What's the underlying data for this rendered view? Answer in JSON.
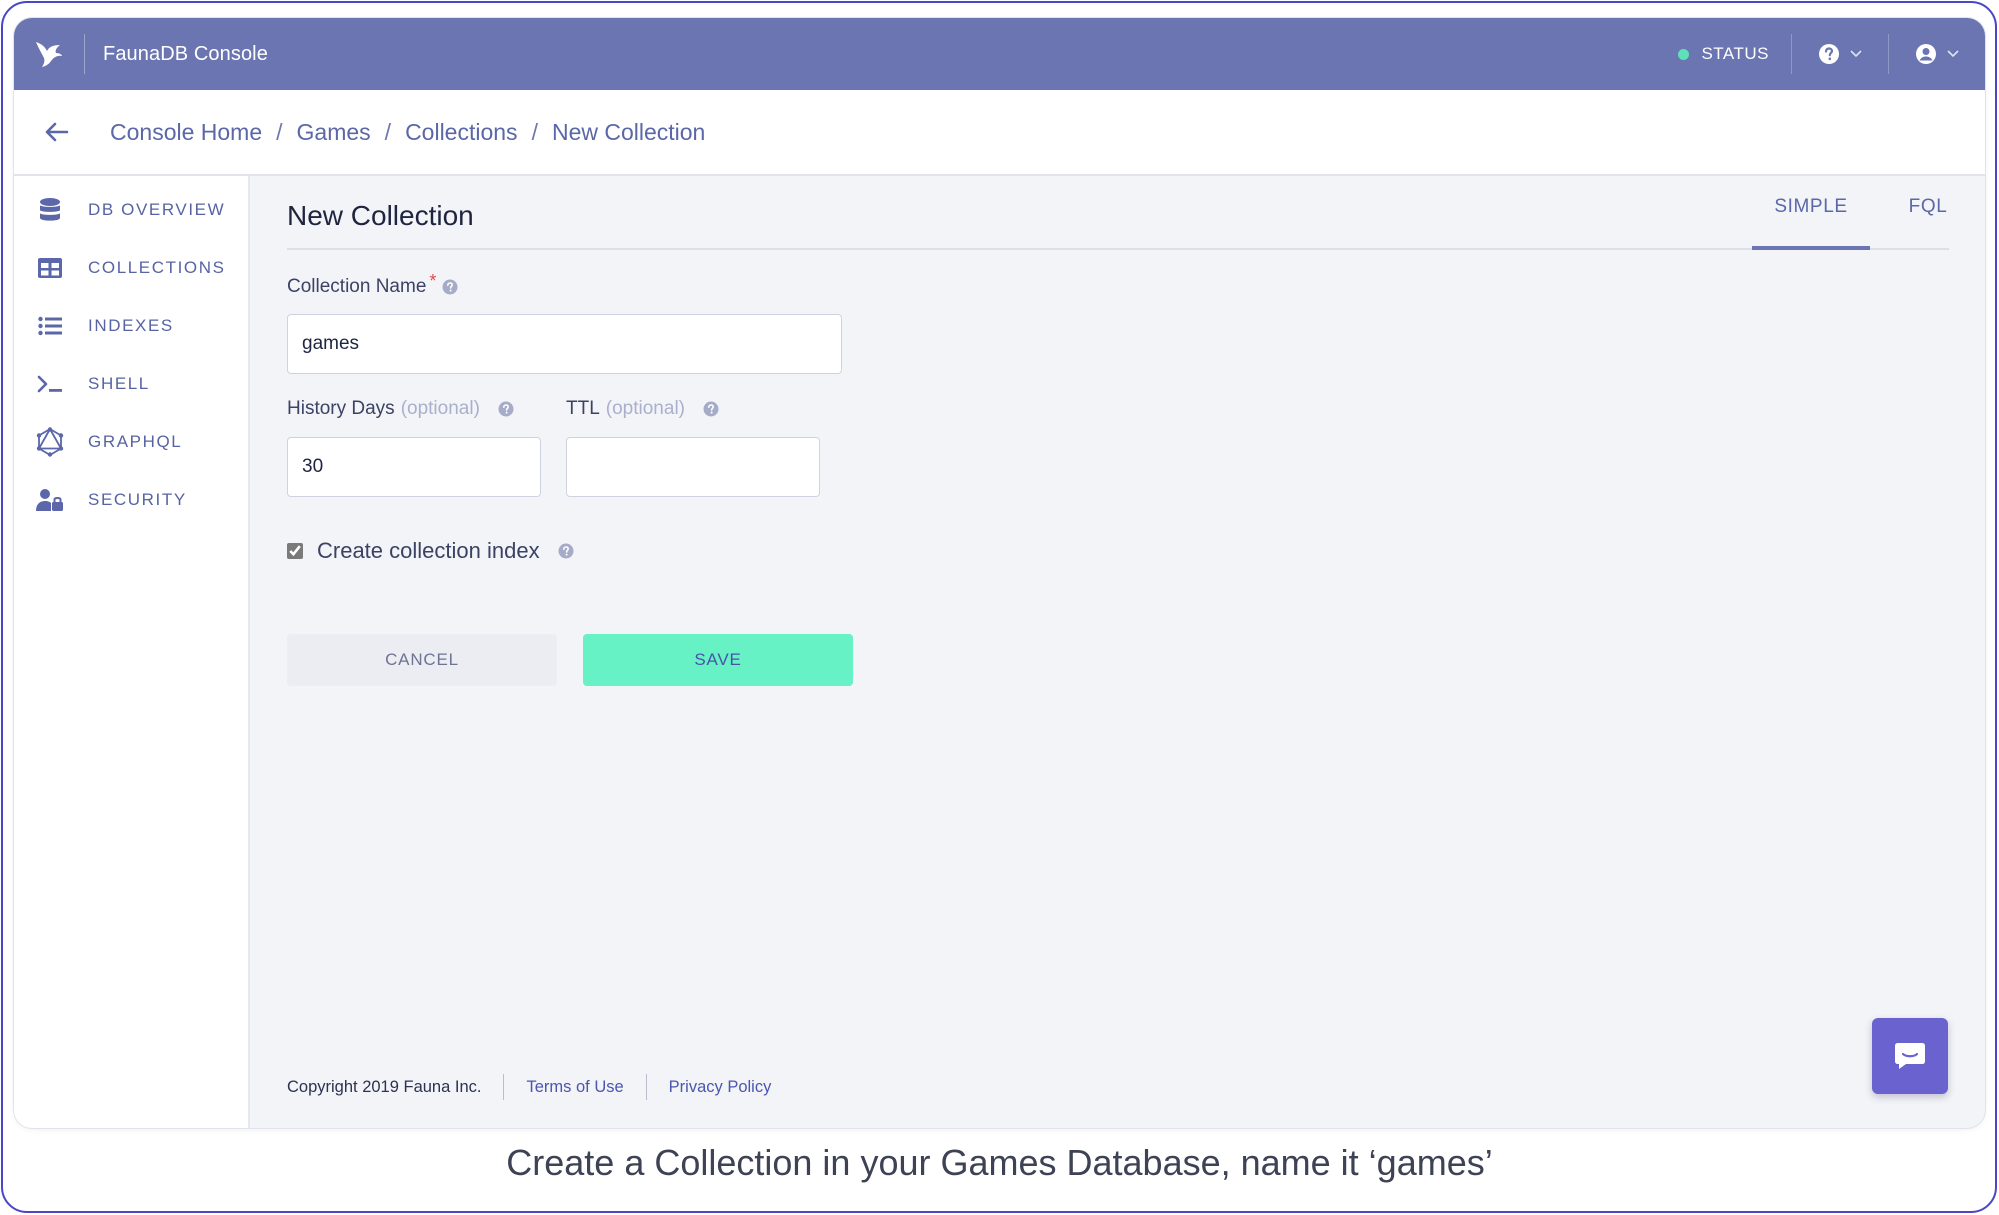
{
  "app": {
    "title": "FaunaDB Console"
  },
  "topbar": {
    "status_label": "STATUS"
  },
  "breadcrumb": {
    "items": [
      "Console Home",
      "Games",
      "Collections",
      "New Collection"
    ],
    "separator": "/"
  },
  "sidebar": {
    "items": [
      {
        "label": "DB OVERVIEW",
        "icon": "database-icon"
      },
      {
        "label": "COLLECTIONS",
        "icon": "table-icon"
      },
      {
        "label": "INDEXES",
        "icon": "list-icon"
      },
      {
        "label": "SHELL",
        "icon": "terminal-icon"
      },
      {
        "label": "GRAPHQL",
        "icon": "graphql-icon"
      },
      {
        "label": "SECURITY",
        "icon": "user-lock-icon"
      }
    ]
  },
  "main": {
    "title": "New Collection",
    "tabs": [
      {
        "label": "SIMPLE",
        "active": true
      },
      {
        "label": "FQL",
        "active": false
      }
    ],
    "form": {
      "collection_name": {
        "label": "Collection Name",
        "required_mark": "*",
        "value": "games"
      },
      "history_days": {
        "label": "History Days",
        "optional": "(optional)",
        "value": "30"
      },
      "ttl": {
        "label": "TTL",
        "optional": "(optional)",
        "value": ""
      },
      "create_index": {
        "label": "Create collection index",
        "checked": true
      },
      "cancel_label": "CANCEL",
      "save_label": "SAVE"
    },
    "footer": {
      "copyright": "Copyright 2019 Fauna Inc.",
      "terms": "Terms of Use",
      "privacy": "Privacy Policy"
    }
  },
  "caption": "Create a Collection in your Games Database, name it ‘games’",
  "colors": {
    "topbar": "#6a75b1",
    "accent": "#5b67a8",
    "save": "#66f2c4",
    "status_dot": "#5fe0b8",
    "chat": "#6a63cf"
  }
}
